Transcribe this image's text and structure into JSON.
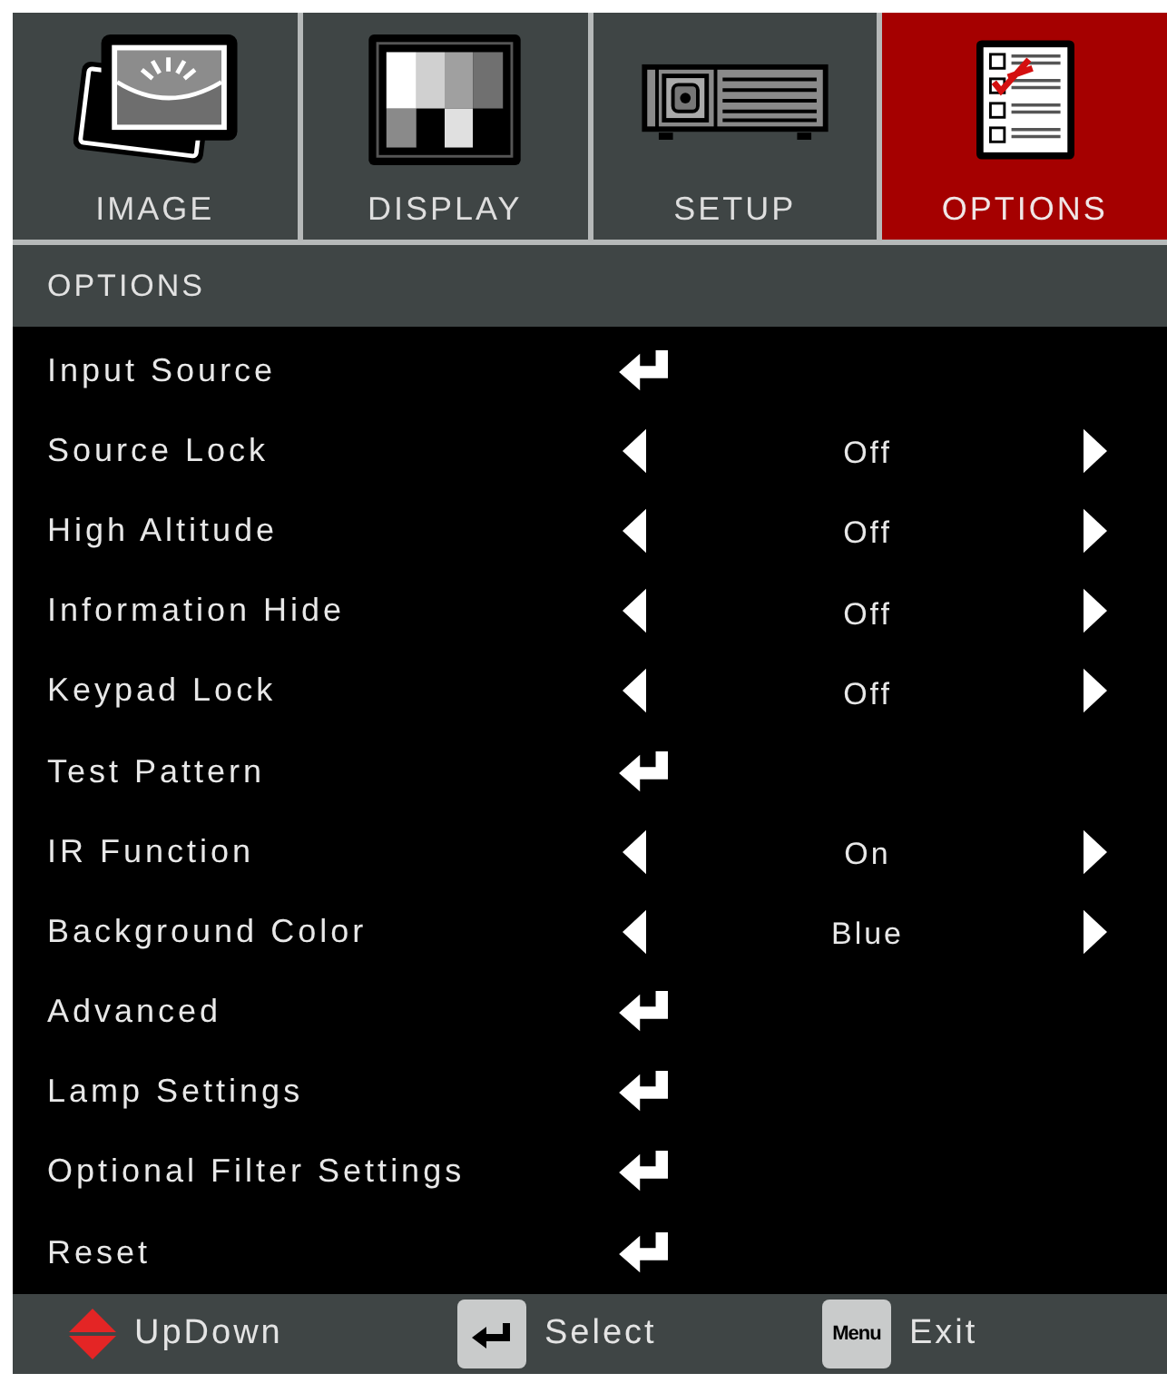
{
  "tabs": [
    {
      "label": "IMAGE",
      "selected": false
    },
    {
      "label": "DISPLAY",
      "selected": false
    },
    {
      "label": "SETUP",
      "selected": false
    },
    {
      "label": "OPTIONS",
      "selected": true
    }
  ],
  "section_title": "OPTIONS",
  "items": [
    {
      "kind": "submenu",
      "label": "Input Source"
    },
    {
      "kind": "choice",
      "label": "Source Lock",
      "value": "Off"
    },
    {
      "kind": "choice",
      "label": "High Altitude",
      "value": "Off"
    },
    {
      "kind": "choice",
      "label": "Information Hide",
      "value": "Off"
    },
    {
      "kind": "choice",
      "label": "Keypad Lock",
      "value": "Off"
    },
    {
      "kind": "submenu",
      "label": "Test Pattern"
    },
    {
      "kind": "choice",
      "label": "IR Function",
      "value": "On"
    },
    {
      "kind": "choice",
      "label": "Background Color",
      "value": "Blue"
    },
    {
      "kind": "submenu",
      "label": "Advanced"
    },
    {
      "kind": "submenu",
      "label": "Lamp Settings"
    },
    {
      "kind": "submenu",
      "label": "Optional Filter Settings"
    },
    {
      "kind": "submenu",
      "label": "Reset"
    }
  ],
  "footer": [
    {
      "kind": "updown",
      "label": "UpDown"
    },
    {
      "kind": "enter",
      "label": "Select"
    },
    {
      "kind": "menu",
      "key_label": "Menu",
      "label": "Exit"
    }
  ]
}
